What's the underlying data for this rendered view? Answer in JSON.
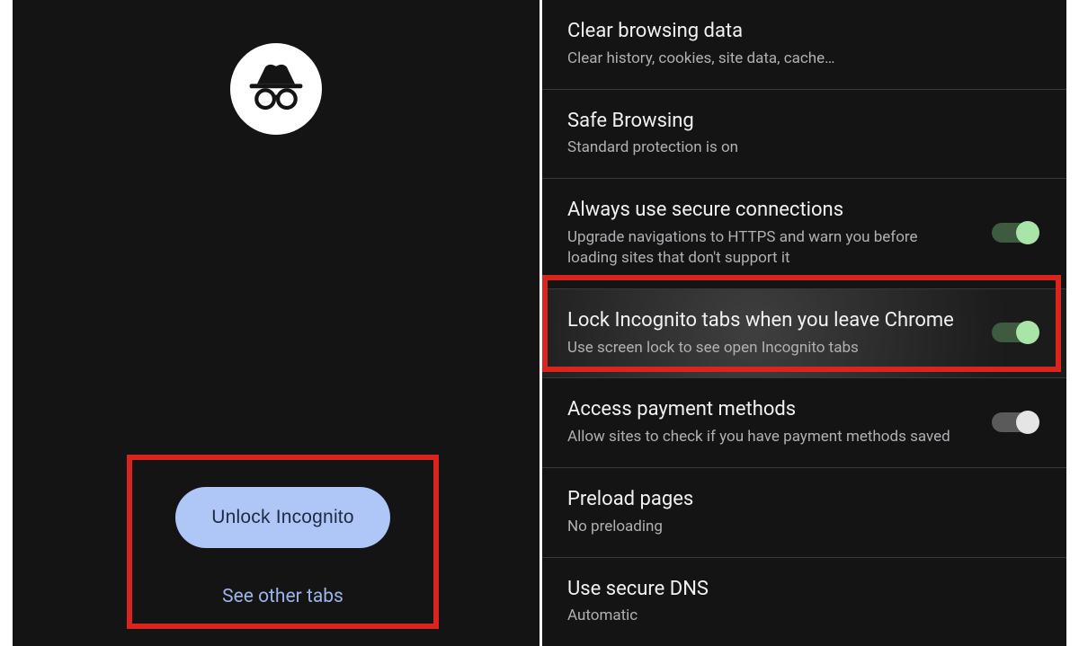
{
  "left_panel": {
    "unlock_label": "Unlock Incognito",
    "see_other_label": "See other tabs"
  },
  "settings": {
    "rows": [
      {
        "title": "Clear browsing data",
        "sub": "Clear history, cookies, site data, cache…",
        "toggle": null
      },
      {
        "title": "Safe Browsing",
        "sub": "Standard protection is on",
        "toggle": null
      },
      {
        "title": "Always use secure connections",
        "sub": "Upgrade navigations to HTTPS and warn you before loading sites that don't support it",
        "toggle": "on"
      },
      {
        "title": "Lock Incognito tabs when you leave Chrome",
        "sub": "Use screen lock to see open Incognito tabs",
        "toggle": "on"
      },
      {
        "title": "Access payment methods",
        "sub": "Allow sites to check if you have payment methods saved",
        "toggle": "off"
      },
      {
        "title": "Preload pages",
        "sub": "No preloading",
        "toggle": null
      },
      {
        "title": "Use secure DNS",
        "sub": "Automatic",
        "toggle": null
      }
    ]
  }
}
